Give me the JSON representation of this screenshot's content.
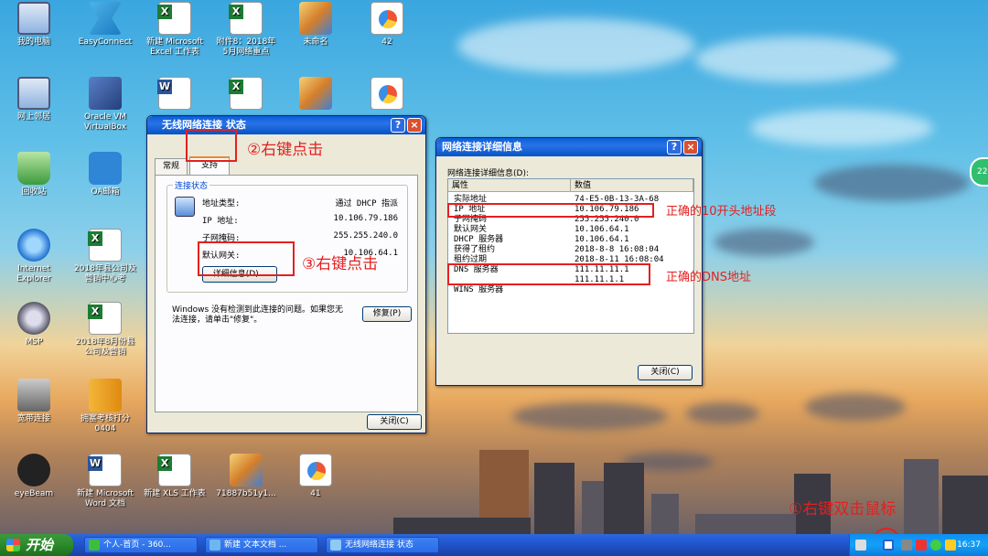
{
  "desktop_icons": [
    {
      "label": "我的电脑",
      "type": "pc",
      "icon": "computer-icon"
    },
    {
      "label": "EasyConnect",
      "type": "ec",
      "icon": "easyconnect-icon"
    },
    {
      "label": "新建 Microsoft Excel 工作表",
      "type": "xls",
      "icon": "excel-icon"
    },
    {
      "label": "附件8：2018年5月网络重点",
      "type": "xls",
      "icon": "excel-icon"
    },
    {
      "label": "未命名",
      "type": "paint",
      "icon": "paint-icon"
    },
    {
      "label": "42",
      "type": "ppt",
      "icon": "image-icon"
    },
    {
      "label": "网上邻居",
      "type": "pc",
      "icon": "network-places-icon"
    },
    {
      "label": "Oracle VM VirtualBox",
      "type": "vbox",
      "icon": "virtualbox-icon"
    },
    {
      "label": "",
      "type": "doc",
      "icon": "word-icon"
    },
    {
      "label": "",
      "type": "xls",
      "icon": "excel-icon"
    },
    {
      "label": "",
      "type": "paint",
      "icon": "paint-icon"
    },
    {
      "label": "",
      "type": "ppt",
      "icon": "image-icon"
    },
    {
      "label": "回收站",
      "type": "bin",
      "icon": "recycle-bin-icon"
    },
    {
      "label": "OA邮箱",
      "type": "mail",
      "icon": "mail-icon"
    },
    {
      "label": "Internet Explorer",
      "type": "ie",
      "icon": "internet-explorer-icon"
    },
    {
      "label": "2018年县公司及营销中心考",
      "type": "xls",
      "icon": "excel-icon"
    },
    {
      "label": "MSP",
      "type": "msp",
      "icon": "msp-icon"
    },
    {
      "label": "2018年8月份县公司及营销",
      "type": "xls",
      "icon": "excel-icon"
    },
    {
      "label": "宽带连接",
      "type": "net",
      "icon": "broadband-icon"
    },
    {
      "label": "拥塞考核打分0404",
      "type": "zip",
      "icon": "archive-icon"
    },
    {
      "label": "eyeBeam",
      "type": "eye",
      "icon": "eyebeam-icon"
    },
    {
      "label": "新建 Microsoft Word 文档",
      "type": "doc",
      "icon": "word-icon"
    },
    {
      "label": "新建 XLS 工作表",
      "type": "xls",
      "icon": "excel-icon"
    },
    {
      "label": "71887b51y1...",
      "type": "paint",
      "icon": "image-icon"
    },
    {
      "label": "41",
      "type": "ppt",
      "icon": "image-icon"
    }
  ],
  "status_window": {
    "title": "无线网络连接 状态",
    "help": "?",
    "close": "×",
    "tabs": [
      "常规",
      "支持"
    ],
    "group_label": "连接状态",
    "rows": [
      {
        "k": "地址类型:",
        "v": "通过 DHCP 指派"
      },
      {
        "k": "IP 地址:",
        "v": "10.106.79.186"
      },
      {
        "k": "子网掩码:",
        "v": "255.255.240.0"
      },
      {
        "k": "默认网关:",
        "v": "10.106.64.1"
      }
    ],
    "details_button": "详细信息(D)...",
    "repair_text": "Windows 没有检测到此连接的问题。如果您无法连接，请单击\"修复\"。",
    "repair_button": "修复(P)",
    "close_button": "关闭(C)"
  },
  "details_window": {
    "title": "网络连接详细信息",
    "help": "?",
    "close": "×",
    "caption": "网络连接详细信息(D):",
    "col_property": "属性",
    "col_value": "数值",
    "rows": [
      {
        "k": "实际地址",
        "v": "74-E5-0B-13-3A-68"
      },
      {
        "k": "IP 地址",
        "v": "10.106.79.186"
      },
      {
        "k": "子网掩码",
        "v": "255.255.240.0"
      },
      {
        "k": "默认网关",
        "v": "10.106.64.1"
      },
      {
        "k": "DHCP 服务器",
        "v": "10.106.64.1"
      },
      {
        "k": "获得了租约",
        "v": "2018-8-8 16:08:04"
      },
      {
        "k": "租约过期",
        "v": "2018-8-11 16:08:04"
      },
      {
        "k": "DNS 服务器",
        "v": "111.11.11.1"
      },
      {
        "k": "",
        "v": "111.11.1.1"
      },
      {
        "k": "WINS 服务器",
        "v": ""
      }
    ],
    "close_button": "关闭(C)"
  },
  "annotations": {
    "step1": "①右键双击鼠标",
    "step2": "②右键点击",
    "step3": "③右键点击",
    "ip_note": "正确的10开头地址段",
    "dns_note": "正确的DNS地址"
  },
  "taskbar": {
    "start": "开始",
    "buttons": [
      {
        "label": "个人-首页 - 360...",
        "icon": "browser-360-icon",
        "color": "#3dbd3d"
      },
      {
        "label": "新建 文本文档 ...",
        "icon": "notepad-icon",
        "color": "#6fb6ef"
      },
      {
        "label": "无线网络连接 状态",
        "icon": "network-icon",
        "color": "#8fc9f6"
      }
    ],
    "clock": "16:37"
  },
  "side_badge": "22"
}
